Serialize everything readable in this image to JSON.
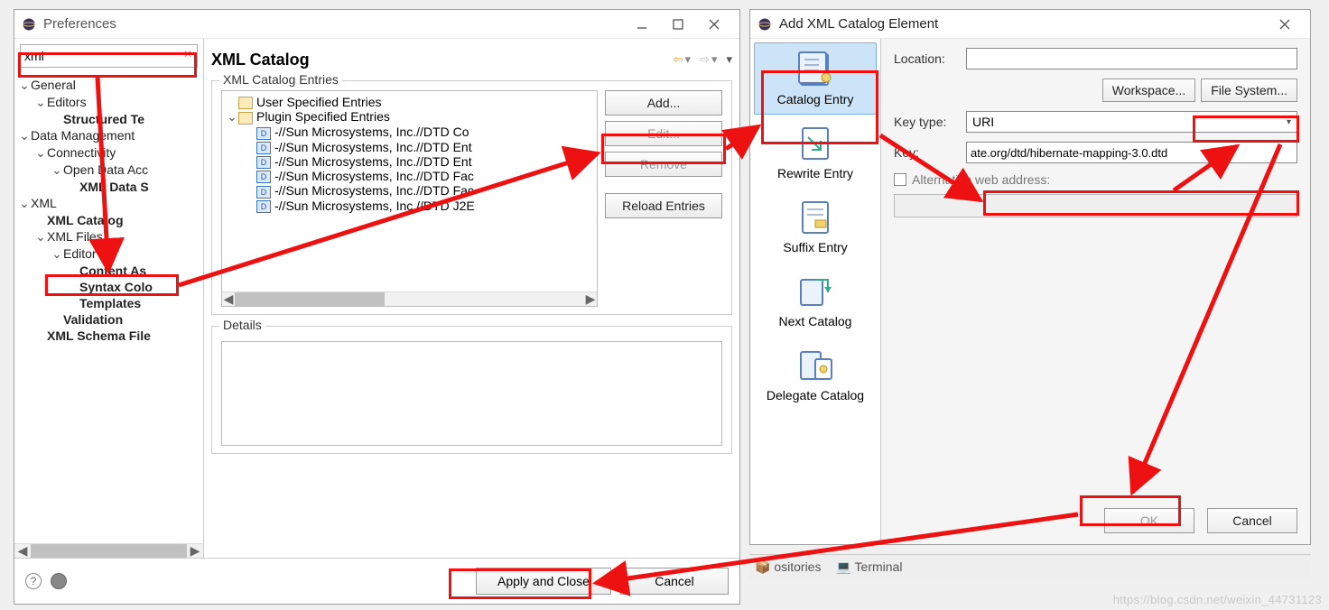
{
  "prefs": {
    "title": "Preferences",
    "filter_value": "xml",
    "tree": {
      "general": "General",
      "editors": "Editors",
      "structured_text": "Structured Te",
      "data_management": "Data Management",
      "connectivity": "Connectivity",
      "open_data_access": "Open Data Acc",
      "xml_data_s": "XML Data S",
      "xml": "XML",
      "xml_catalog": "XML Catalog",
      "xml_files": "XML Files",
      "editor": "Editor",
      "content_assist": "Content As",
      "syntax_col": "Syntax Colo",
      "templates": "Templates",
      "validation": "Validation",
      "xml_schema_files": "XML Schema File"
    },
    "page_title": "XML Catalog",
    "group_entries": "XML Catalog Entries",
    "entries": {
      "user_specified": "User Specified Entries",
      "plugin_specified": "Plugin Specified Entries",
      "rows": [
        "-//Sun Microsystems, Inc.//DTD Co",
        "-//Sun Microsystems, Inc.//DTD Ent",
        "-//Sun Microsystems, Inc.//DTD Ent",
        "-//Sun Microsystems, Inc.//DTD Fac",
        "-//Sun Microsystems, Inc.//DTD Fac",
        "-//Sun Microsystems, Inc.//DTD J2E"
      ]
    },
    "buttons": {
      "add": "Add...",
      "edit": "Edit...",
      "remove": "Remove",
      "reload": "Reload Entries"
    },
    "group_details": "Details",
    "footer": {
      "apply_close": "Apply and Close",
      "cancel": "Cancel"
    }
  },
  "add": {
    "title": "Add XML Catalog Element",
    "types": {
      "catalog_entry": "Catalog Entry",
      "rewrite_entry": "Rewrite Entry",
      "suffix_entry": "Suffix Entry",
      "next_catalog": "Next Catalog",
      "delegate_catalog": "Delegate Catalog"
    },
    "form": {
      "location_label": "Location:",
      "location_value": "",
      "workspace_btn": "Workspace...",
      "filesystem_btn": "File System...",
      "key_type_label": "Key type:",
      "key_type_value": "URI",
      "key_label": "Key:",
      "key_value": "ate.org/dtd/hibernate-mapping-3.0.dtd",
      "alt_web_label": "Alternative web address:"
    },
    "footer": {
      "ok": "OK",
      "cancel": "Cancel"
    }
  },
  "bg_bar": {
    "repositories": "ositories",
    "terminal": "Terminal"
  },
  "watermark": "https://blog.csdn.net/weixin_44731123"
}
